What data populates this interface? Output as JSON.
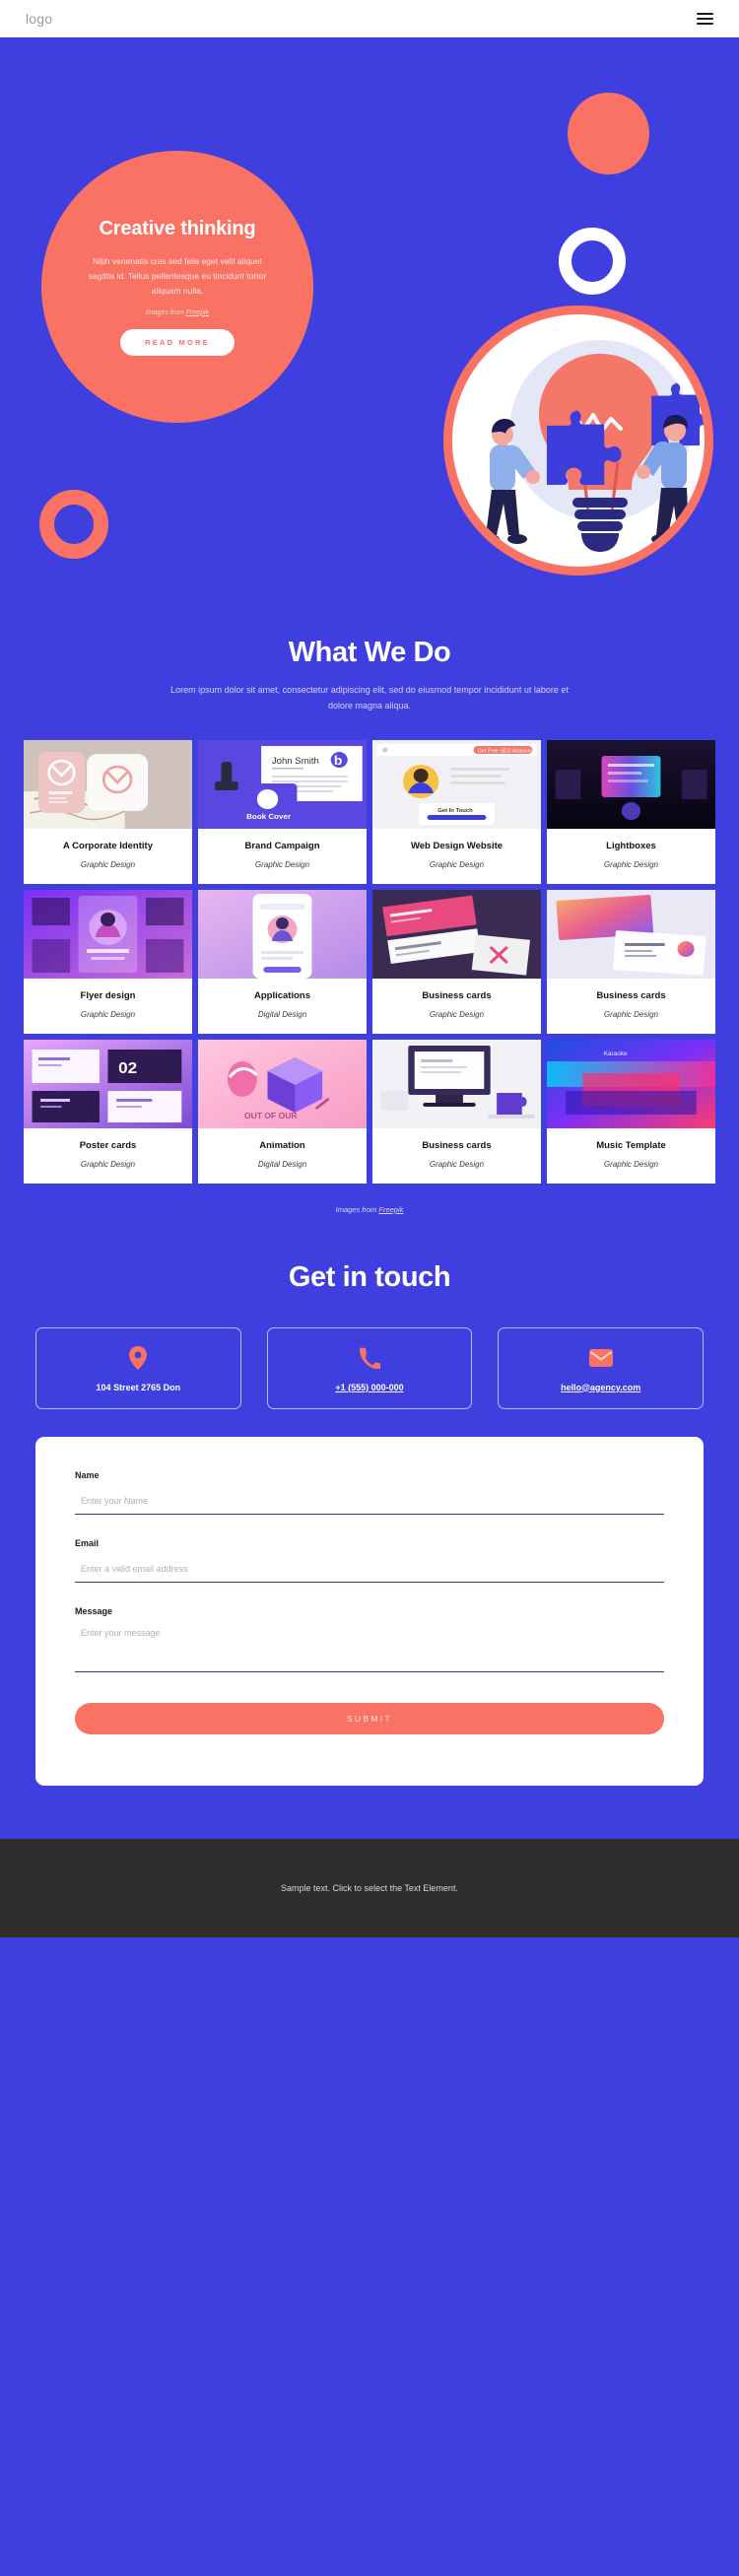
{
  "colors": {
    "brand_blue": "#3f3fe0",
    "accent_coral": "#fa7264",
    "white": "#ffffff",
    "footer_dark": "#2f2d2b"
  },
  "header": {
    "logo": "logo",
    "menu_icon": "hamburger-icon"
  },
  "hero": {
    "title": "Creative thinking",
    "subtitle": "Nibh venenatis cras sed felis eget velit aliquet sagittis id. Tellus pellentesque eu tincidunt tortor aliquam nulla.",
    "credit_prefix": "Images from ",
    "credit_link": "Freepik",
    "cta_label": "READ MORE"
  },
  "what_we_do": {
    "title": "What We Do",
    "subtitle": "Lorem ipsum dolor sit amet, consectetur adipiscing elit, sed do eiusmod tempor incididunt ut labore et dolore magna aliqua.",
    "credit_prefix": "Images from ",
    "credit_link": "Freepik",
    "items": [
      {
        "title": "A Corporate Identity",
        "category": "Graphic Design",
        "thumb": "corporate-identity-thumb"
      },
      {
        "title": "Brand Campaign",
        "category": "Graphic Design",
        "thumb": "brand-campaign-thumb"
      },
      {
        "title": "Web Design Website",
        "category": "Graphic Design",
        "thumb": "web-design-thumb"
      },
      {
        "title": "Lightboxes",
        "category": "Graphic Design",
        "thumb": "lightboxes-thumb"
      },
      {
        "title": "Flyer design",
        "category": "Graphic Design",
        "thumb": "flyer-design-thumb"
      },
      {
        "title": "Applications",
        "category": "Digital Design",
        "thumb": "applications-thumb"
      },
      {
        "title": "Business cards",
        "category": "Graphic Design",
        "thumb": "business-cards-1-thumb"
      },
      {
        "title": "Business cards",
        "category": "Graphic Design",
        "thumb": "business-cards-2-thumb"
      },
      {
        "title": "Poster cards",
        "category": "Graphic Design",
        "thumb": "poster-cards-thumb"
      },
      {
        "title": "Animation",
        "category": "Digital Design",
        "thumb": "animation-thumb"
      },
      {
        "title": "Business cards",
        "category": "Graphic Design",
        "thumb": "business-cards-3-thumb"
      },
      {
        "title": "Music Template",
        "category": "Graphic Design",
        "thumb": "music-template-thumb"
      }
    ]
  },
  "contact": {
    "title": "Get in touch",
    "cards": [
      {
        "icon": "location-pin-icon",
        "text": "104 Street 2765 Don",
        "underline": false
      },
      {
        "icon": "phone-icon",
        "text": "+1 (555) 000-000",
        "underline": true
      },
      {
        "icon": "envelope-icon",
        "text": "hello@agency.com",
        "underline": true
      }
    ],
    "form": {
      "name_label": "Name",
      "name_placeholder": "Enter your Name",
      "email_label": "Email",
      "email_placeholder": "Enter a valid email address",
      "message_label": "Message",
      "message_placeholder": "Enter your message",
      "submit_label": "SUBMIT"
    }
  },
  "footer": {
    "text": "Sample text. Click to select the Text Element."
  }
}
